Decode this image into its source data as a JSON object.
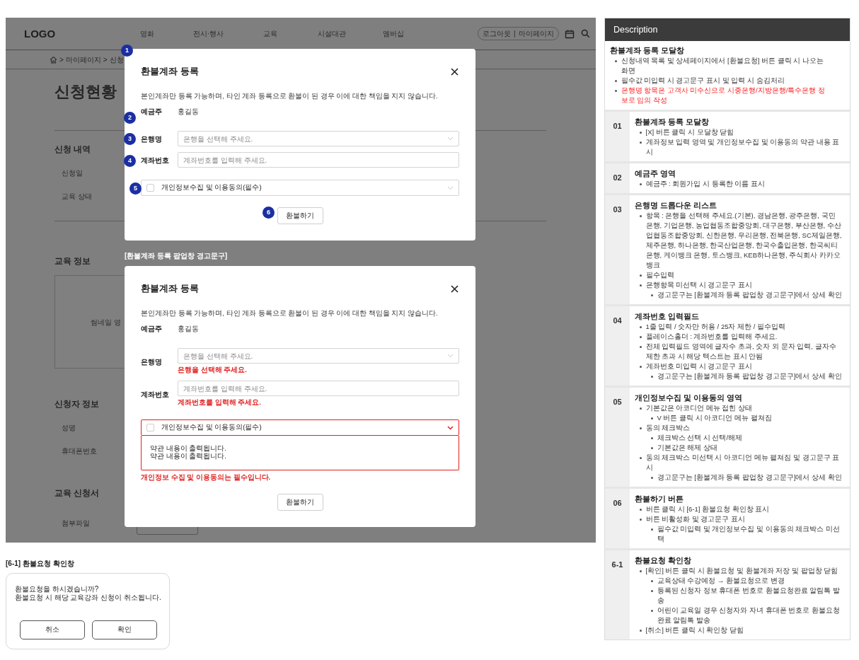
{
  "page": {
    "logo": "LOGO",
    "nav": [
      "영화",
      "전시·행사",
      "교육",
      "시설대관",
      "멤버십"
    ],
    "account": {
      "links": [
        "로그아웃",
        "마이페이지"
      ],
      "separator": "|"
    },
    "breadcrumb": {
      "separator": ">",
      "items": [
        "마이페이지",
        "신청"
      ]
    },
    "title": "신청현황",
    "sections": [
      {
        "heading": "신청 내역",
        "fields": [
          "신청일",
          "교육 상태"
        ]
      },
      {
        "heading": "교육 정보",
        "thumbnail": "썸네일 영"
      },
      {
        "heading": "신청자 정보",
        "fields": [
          "성명",
          "휴대폰번호"
        ]
      },
      {
        "heading": "교육 신청서",
        "fields": [
          "첨부파일"
        ]
      }
    ]
  },
  "refund_modal": {
    "marker": "1",
    "title": "환불계좌 등록",
    "notice": "본인계좌만 등록 가능하며, 타인 계좌 등록으로 환불이 된 경우 이에 대한 책임을 지지 않습니다.",
    "holder": {
      "marker": "2",
      "label": "예금주",
      "value": "홍길동"
    },
    "bank": {
      "marker": "3",
      "label": "은행명",
      "placeholder": "은행을 선택해 주세요."
    },
    "account": {
      "marker": "4",
      "label": "계좌번호",
      "placeholder": "계좌번호를 입력해 주세요."
    },
    "consent": {
      "marker": "5",
      "label": "개인정보수집 및 이용동의(필수)",
      "checked": false,
      "expanded": false
    },
    "submit": {
      "marker": "6",
      "label": "환불하기"
    }
  },
  "warning_caption": "[환불계좌 등록 팝업창 경고문구]",
  "refund_modal_warning": {
    "title": "환불계좌 등록",
    "notice": "본인계좌만 등록 가능하며, 타인 계좌 등록으로 환불이 된 경우 이에 대한 책임을 지지 않습니다.",
    "holder": {
      "label": "예금주",
      "value": "홍길동"
    },
    "bank": {
      "label": "은행명",
      "placeholder": "은행을 선택해 주세요.",
      "error": "은행을 선택해 주세요."
    },
    "account": {
      "label": "계좌번호",
      "placeholder": "계좌번호를 입력해 주세요.",
      "error": "계좌번호를 입력해 주세요."
    },
    "consent": {
      "label": "개인정보수집 및 이용동의(필수)",
      "checked": false,
      "expanded": true,
      "terms": [
        "약관 내용이 출력됩니다.",
        "약관 내용이 출력됩니다."
      ],
      "error": "개인정보 수집 및 이용동의는 필수입니다."
    },
    "submit": {
      "label": "환불하기"
    }
  },
  "confirm_caption": "[6-1] 환불요청 확인창",
  "confirm_dialog": {
    "message": [
      "환불요청을 하시겠습니까?",
      "환불요청 시 해당 교육강좌 신청이 취소됩니다."
    ],
    "buttons": [
      "취소",
      "확인"
    ]
  },
  "description": {
    "header": "Description",
    "intro": {
      "title": "환불계좌 등록 모달창",
      "bullets": [
        {
          "text": "신청내역 목록 및 상세페이지에서 [환불요청] 버튼 클릭 시 나오는 화면",
          "emphasis": false
        },
        {
          "text": "필수값 미입력 시 경고문구 표시 및 입력 시 숨김처리",
          "emphasis": false
        },
        {
          "text": "은행명 항목은 고객사 미수신으로 시중은행/지방은행/특수은행 정보로 임의 작성",
          "emphasis": true
        }
      ]
    },
    "rows": [
      {
        "number": "01",
        "title": "환불계좌 등록 모달창",
        "bullets": [
          {
            "text": "[X] 버튼 클릭 시 모달창 닫힘"
          },
          {
            "text": "계좌정보 입력 영역 및 개인정보수집 및 이용동의 약관 내용 표시"
          }
        ]
      },
      {
        "number": "02",
        "title": "예금주 영역",
        "bullets": [
          {
            "text": "예금주 : 회원가입 시 등록한 이름 표시"
          }
        ]
      },
      {
        "number": "03",
        "title": "은행명 드롭다운 리스트",
        "bullets": [
          {
            "text": "항목 : 은행을 선택해 주세요.(기본), 경남은행, 광주은행, 국민은행, 기업은행, 농업협동조합중앙회, 대구은행, 부산은행, 수산업협동조합중앙회, 신한은행, 우리은행, 전북은행, SC제일은행, 제주은행, 하나은행, 한국산업은행, 한국수출입은행, 한국씨티은행, 케이뱅크 은행, 토스뱅크, KEB하나은행, 주식회사 카카오뱅크"
          },
          {
            "text": "필수입력"
          },
          {
            "text": "은행항목 미선택 시 경고문구 표시",
            "children": [
              {
                "text": "경고문구는 [환불계좌 등록 팝업창 경고문구]에서 상세 확인"
              }
            ]
          }
        ]
      },
      {
        "number": "04",
        "title": "계좌번호 입력필드",
        "bullets": [
          {
            "text": "1줄 입력 / 숫자만 허용 / 25자 제한 / 필수입력"
          },
          {
            "text": "플레이스홀더 : 계좌번호를 입력해 주세요."
          },
          {
            "text": "전체 입력필드 영역에 글자수 초과, 숫자 외 문자 입력, 글자수 제한 초과 시 해당 텍스트는 표시 안됨"
          },
          {
            "text": "계좌번호 미입력 시 경고문구 표시",
            "children": [
              {
                "text": "경고문구는 [환불계좌 등록 팝업창 경고문구]에서 상세 확인"
              }
            ]
          }
        ]
      },
      {
        "number": "05",
        "title": "개인정보수집 및 이용동의 영역",
        "bullets": [
          {
            "text": "기본값은 아코디언 메뉴 접힌 상태",
            "children": [
              {
                "text": "V 버튼 클릭 시 아코디언 메뉴 펼쳐짐"
              }
            ]
          },
          {
            "text": "동의 체크박스",
            "children": [
              {
                "text": "체크박스 선택 시 선택/해제"
              },
              {
                "text": "기본값은 해제 상태"
              }
            ]
          },
          {
            "text": "동의 체크박스 미선택 시 아코디언 메뉴 펼쳐짐 및 경고문구 표시",
            "children": [
              {
                "text": "경고문구는 [환불계좌 등록 팝업창 경고문구]에서 상세 확인"
              }
            ]
          }
        ]
      },
      {
        "number": "06",
        "title": "환불하기 버튼",
        "bullets": [
          {
            "text": "버튼 클릭 시 [6-1] 환불요청 확인창 표시"
          },
          {
            "text": "버튼 비활성화 및 경고문구 표시",
            "children": [
              {
                "text": "필수값 미입력 및 개인정보수집 및 이용동의 체크박스 미선택"
              }
            ]
          }
        ]
      },
      {
        "number": "6-1",
        "title": "환불요청 확인창",
        "bullets": [
          {
            "text": "[확인] 버튼 클릭 시 환불요청 및 환불계좌 저장 및 팝업창 닫힘",
            "children": [
              {
                "text": "교육상태 수강예정 → 환불요청으로 변경"
              },
              {
                "text": "등록된 신청자 정보 휴대폰 번호로 환불요청완료 알림톡 발송"
              },
              {
                "text": "어린이 교육일 경우 신청자와 자녀 휴대폰 번호로 환불요청완료 알림톡 발송"
              }
            ]
          },
          {
            "text": "[취소] 버튼 클릭 시 확인창 닫힘"
          }
        ]
      }
    ]
  }
}
